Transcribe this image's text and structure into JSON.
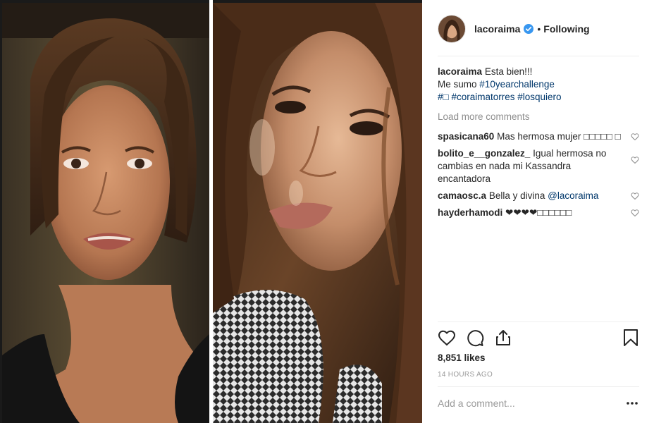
{
  "header": {
    "username": "lacoraima",
    "separator": "•",
    "follow_status": "Following"
  },
  "caption": {
    "username": "lacoraima",
    "line1": "Esta bien!!!",
    "line2_prefix": "Me sumo",
    "hashtag1": "#10yearchallenge",
    "hashtag2": "#□",
    "hashtag3": "#coraimatorres",
    "hashtag4": "#losquiero"
  },
  "load_more": "Load more comments",
  "comments": [
    {
      "username": "spasicana60",
      "text": "Mas hermosa mujer □□□□□ □"
    },
    {
      "username": "bolito_e__gonzalez_",
      "text": "Igual hermosa no cambias en nada mi Kassandra encantadora"
    },
    {
      "username": "camaosc.a",
      "text": "Bella y divina",
      "mention": "@lacoraima"
    },
    {
      "username": "hayderhamodi",
      "text": "❤❤❤❤□□□□□□"
    }
  ],
  "likes": "8,851 likes",
  "time": "14 HOURS AGO",
  "add_comment_placeholder": "Add a comment...",
  "icons": {
    "verified": "verified-badge-icon",
    "like": "heart-icon",
    "comment": "comment-bubble-icon",
    "share": "share-icon",
    "save": "bookmark-icon",
    "more": "more-options-icon"
  },
  "colors": {
    "verified": "#3897f0",
    "hashtag": "#00376b",
    "muted": "#8e8e8e"
  }
}
